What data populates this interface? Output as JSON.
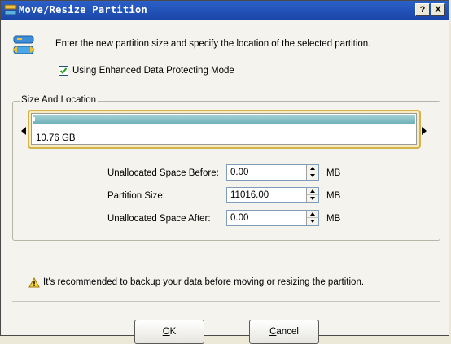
{
  "window": {
    "title": "Move/Resize Partition",
    "help_label": "?",
    "close_label": "X"
  },
  "instruction": "Enter the new partition size and specify the location of the selected partition.",
  "protect_mode": {
    "label": "Using Enhanced Data Protecting Mode",
    "checked": true
  },
  "size_and_location": {
    "title": "Size And Location",
    "partition_size_display": "10.76 GB"
  },
  "fields": [
    {
      "label": "Unallocated Space Before:",
      "value": "0.00",
      "unit": "MB"
    },
    {
      "label": "Partition Size:",
      "value": "11016.00",
      "unit": "MB"
    },
    {
      "label": "Unallocated Space After:",
      "value": "0.00",
      "unit": "MB"
    }
  ],
  "warning": "It's recommended to backup your data before moving or resizing the partition.",
  "buttons": {
    "ok": "OK",
    "cancel": "Cancel"
  },
  "colors": {
    "titlebar": "#1a46a8",
    "partition_bar": "#6fb0b8",
    "partition_frame": "#d4b24c"
  },
  "icons": {
    "app": "partition-app-icon",
    "main": "move-resize-icon",
    "warning": "warning-triangle-icon"
  }
}
